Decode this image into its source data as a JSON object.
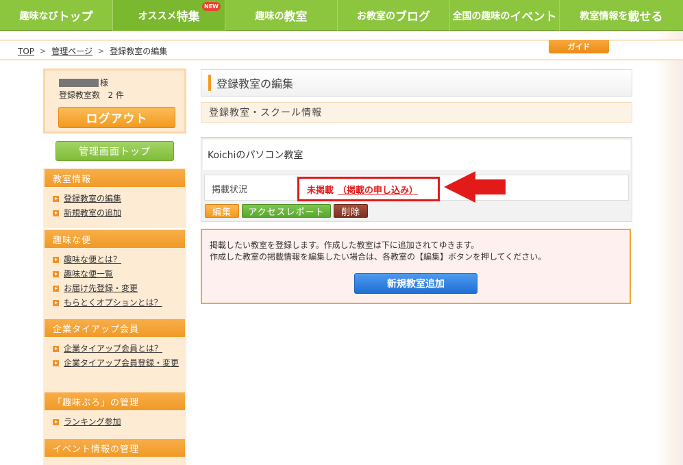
{
  "nav": {
    "items": [
      {
        "pre": "趣味なび",
        "big": "トップ",
        "post": ""
      },
      {
        "pre": "オススメ",
        "big": "特集",
        "post": "",
        "badge": "NEW"
      },
      {
        "pre": "趣味の",
        "big": "教室",
        "post": ""
      },
      {
        "pre": "お教室の",
        "big": "ブログ",
        "post": ""
      },
      {
        "pre": "全国の趣味の",
        "big": "イベント",
        "post": ""
      },
      {
        "pre": "教室情報を",
        "big": "載せる",
        "post": ""
      }
    ]
  },
  "breadcrumb": {
    "top": "TOP",
    "admin": "管理ページ",
    "current": "登録教室の編集",
    "sep": ">"
  },
  "guide": "ガイド",
  "sidebar": {
    "user_suffix": "様",
    "count_label": "登録教室数",
    "count_value": "2 件",
    "logout": "ログアウト",
    "admin_top": "管理画面トップ",
    "sections": [
      {
        "title": "教室情報",
        "items": [
          "登録教室の編集",
          "新規教室の追加"
        ]
      },
      {
        "title": "趣味な便",
        "items": [
          "趣味な便とは？",
          "趣味な便一覧",
          "お届け先登録・変更",
          "もらとくオプションとは？"
        ]
      },
      {
        "title": "企業タイアップ会員",
        "items": [
          "企業タイアップ会員とは？",
          "企業タイアップ会員登録・変更"
        ]
      },
      {
        "title": "「趣味ぶろ」の管理",
        "items": [
          "ランキング参加"
        ]
      },
      {
        "title": "イベント情報の管理",
        "items": []
      }
    ]
  },
  "main": {
    "title": "登録教室の編集",
    "subtitle": "登録教室・スクール情報",
    "school_name": "Koichiのパソコン教室",
    "status_label": "掲載状況",
    "status_value": "未掲載",
    "status_apply": "（掲載の申し込み）",
    "btn_edit": "編集",
    "btn_report": "アクセスレポート",
    "btn_delete": "削除",
    "info_line1": "掲載したい教室を登録します。作成した教室は下に追加されてゆきます。",
    "info_line2": "作成した教室の掲載情報を編集したい場合は、各教室の【編集】ボタンを押してください。",
    "btn_add": "新規教室追加"
  },
  "colors": {
    "nav_green": "#8cc63f",
    "orange": "#f39a1e",
    "alert_red": "#e21a1a",
    "add_blue": "#1f6fd3"
  }
}
